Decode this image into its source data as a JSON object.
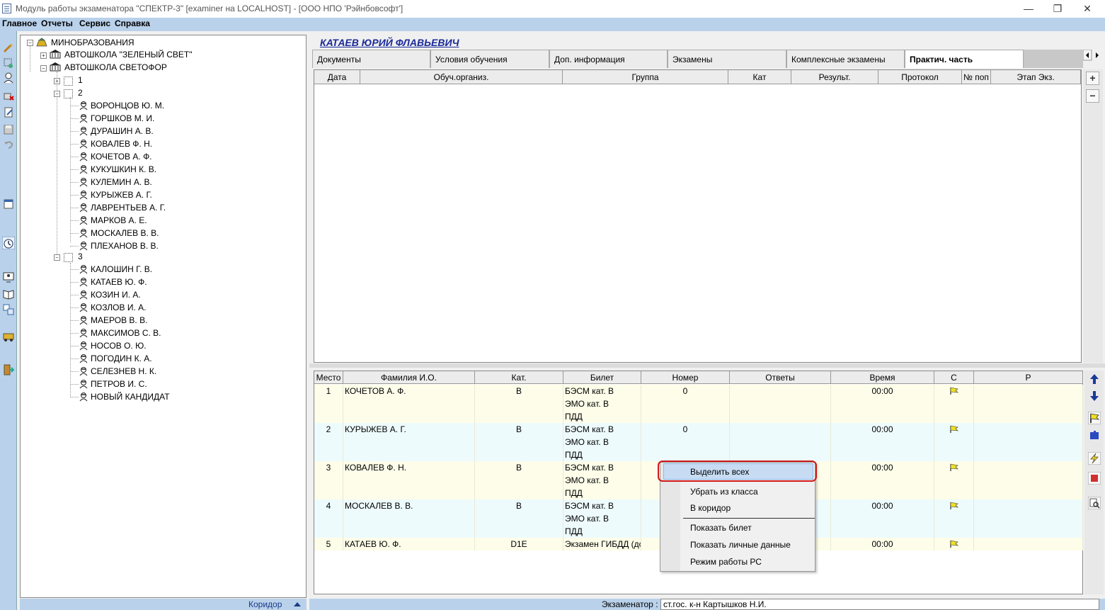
{
  "window": {
    "title": "Модуль работы экзаменатора \"СПЕКТР-3\" [examiner на LOCALHOST] - [ООО НПО 'Рэйнбовсофт']",
    "minimize": "—",
    "restore": "❐",
    "close": "✕"
  },
  "menu": [
    "Главное",
    "Отчеты",
    "Сервис",
    "Справка"
  ],
  "tree": {
    "root": "МИНОБРАЗОВАНИЯ",
    "schools": [
      "АВТОШКОЛА \"ЗЕЛЕНЫЙ СВЕТ\"",
      "АВТОШКОЛА СВЕТОФОР"
    ],
    "groups": [
      "1",
      "2",
      "3"
    ],
    "group2_people": [
      "ВОРОНЦОВ Ю. М.",
      "ГОРШКОВ М. И.",
      "ДУРАШИН А. В.",
      "КОВАЛЕВ Ф. Н.",
      "КОЧЕТОВ А. Ф.",
      "КУКУШКИН К. В.",
      "КУЛЕМИН А. В.",
      "КУРЫЖЕВ А. Г.",
      "ЛАВРЕНТЬЕВ А. Г.",
      "МАРКОВ А. Е.",
      "МОСКАЛЕВ В. В.",
      "ПЛЕХАНОВ В. В."
    ],
    "group3_people": [
      "КАЛОШИН Г. В.",
      "КАТАЕВ Ю. Ф.",
      "КОЗИН И. А.",
      "КОЗЛОВ И. А.",
      "МАЕРОВ В. В.",
      "МАКСИМОВ С. В.",
      "НОСОВ О. Ю.",
      "ПОГОДИН К. А.",
      "СЕЛЕЗНЕВ Н. К.",
      "ПЕТРОВ И. С.",
      "НОВЫЙ КАНДИДАТ"
    ]
  },
  "corridor": {
    "label": "Коридор"
  },
  "person": {
    "name": "КАТАЕВ ЮРИЙ ФЛАВЬЕВИЧ"
  },
  "tabs": [
    "Документы",
    "Условия обучения",
    "Доп. информация",
    "Экзамены",
    "Комплексные экзамены",
    "Практич. часть"
  ],
  "grid1": {
    "columns": [
      "Дата",
      "Обуч.организ.",
      "Группа",
      "Кат",
      "Результ.",
      "Протокол",
      "№ поп",
      "Этап Экз."
    ],
    "plus": "+",
    "minus": "−"
  },
  "grid2": {
    "columns": [
      "Место",
      "Фамилия И.О.",
      "Кат.",
      "Билет",
      "Номер",
      "Ответы",
      "Время",
      "С",
      "Р"
    ],
    "rows": [
      {
        "place": "1",
        "name": "КОЧЕТОВ А. Ф.",
        "cat": "B",
        "tickets": [
          "БЭСМ кат. В",
          "ЭМО кат. В",
          "ПДД"
        ],
        "number": "0",
        "time": "00:00"
      },
      {
        "place": "2",
        "name": "КУРЫЖЕВ А. Г.",
        "cat": "B",
        "tickets": [
          "БЭСМ кат. В",
          "ЭМО кат. В",
          "ПДД"
        ],
        "number": "0",
        "time": "00:00"
      },
      {
        "place": "3",
        "name": "КОВАЛЕВ Ф. Н.",
        "cat": "B",
        "tickets": [
          "БЭСМ кат. В",
          "ЭМО кат. В",
          "ПДД"
        ],
        "number": "",
        "time": "00:00"
      },
      {
        "place": "4",
        "name": "МОСКАЛЕВ В. В.",
        "cat": "B",
        "tickets": [
          "БЭСМ кат. В",
          "ЭМО кат. В",
          "ПДД"
        ],
        "number": "",
        "time": "00:00"
      },
      {
        "place": "5",
        "name": "КАТАЕВ Ю. Ф.",
        "cat": "D1E",
        "tickets": [
          "Экзамен ГИБДД (дс"
        ],
        "number": "",
        "time": "00:00"
      }
    ]
  },
  "context_menu": [
    "Выделить всех",
    "Убрать из класса",
    "В коридор",
    "Показать билет",
    "Показать личные данные",
    "Режим работы РС"
  ],
  "status": {
    "label": "Экзаменатор :",
    "value": "ст.гос. к-н Картышков Н.И."
  },
  "colors": {
    "accent": "#b9d1ea",
    "row_yellow": "#fdfde9",
    "row_cyan": "#eefbfd",
    "highlight": "#d01a1a",
    "name_blue": "#1a2a9a"
  }
}
